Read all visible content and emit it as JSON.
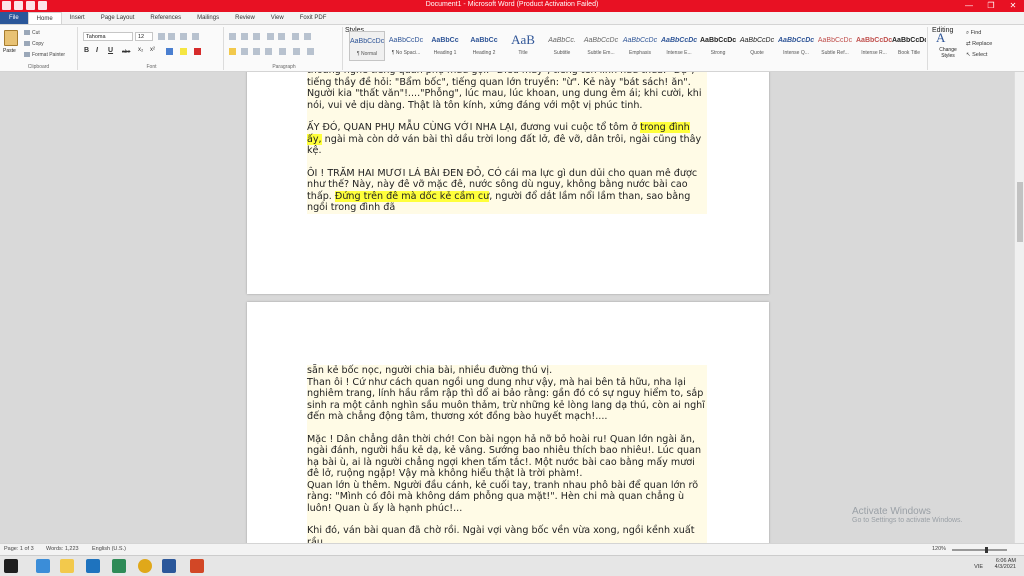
{
  "window": {
    "title": "Document1 - Microsoft Word (Product Activation Failed)",
    "controls": [
      "—",
      "❐",
      "✕"
    ]
  },
  "tabs": [
    "File",
    "Home",
    "Insert",
    "Page Layout",
    "References",
    "Mailings",
    "Review",
    "View",
    "Foxit PDF"
  ],
  "ribbon": {
    "clipboard": {
      "paste": "Paste",
      "cut": "Cut",
      "copy": "Copy",
      "format_painter": "Format Painter",
      "label": "Clipboard"
    },
    "font": {
      "name": "Tahoma",
      "size": "12",
      "label": "Font",
      "bold": "B",
      "italic": "I",
      "underline": "U",
      "strike": "abe",
      "sub": "x₂",
      "sup": "x²"
    },
    "paragraph": {
      "label": "Paragraph"
    },
    "styles": {
      "label": "Styles",
      "items": [
        {
          "sample": "AaBbCcDc",
          "name": "¶ Normal"
        },
        {
          "sample": "AaBbCcDc",
          "name": "¶ No Spaci..."
        },
        {
          "sample": "AaBbCc",
          "name": "Heading 1"
        },
        {
          "sample": "AaBbCc",
          "name": "Heading 2"
        },
        {
          "sample": "AaB",
          "name": "Title"
        },
        {
          "sample": "AaBbCc.",
          "name": "Subtitle"
        },
        {
          "sample": "AaBbCcDc",
          "name": "Subtle Em..."
        },
        {
          "sample": "AaBbCcDc",
          "name": "Emphasis"
        },
        {
          "sample": "AaBbCcDc",
          "name": "Intense E..."
        },
        {
          "sample": "AaBbCcDc",
          "name": "Strong"
        },
        {
          "sample": "AaBbCcDc",
          "name": "Quote"
        },
        {
          "sample": "AaBbCcDc",
          "name": "Intense Q..."
        },
        {
          "sample": "AaBbCcDc",
          "name": "Subtle Ref..."
        },
        {
          "sample": "AaBbCcDc",
          "name": "Intense R..."
        },
        {
          "sample": "AaBbCcDc",
          "name": "Book Title"
        }
      ],
      "change_styles": "Change Styles"
    },
    "editing": {
      "label": "Editing",
      "find": "Find",
      "replace": "Replace",
      "select": "Select"
    }
  },
  "document": {
    "page1_paragraphs": [
      "là nhân nha, dương bệ, ngày ngà. nào quần ngồi trên, nào nha ngồi dưới, người nhà lính lệ khoanh tay sắp hàng, nghi vệ tôn nghiêm, như thần như thánh. Thỉnh thoảng nghe tiếng quan phụ mẫu gọi: \"Điếu mày\", tiếng tên lính hầu thưa: \"Dạ\"; tiếng thầy đề hỏi: \"Bẩm bốc\", tiếng quan lớn truyền: \"ừ\". Kẻ này \"bát sách! ăn\". Người kia \"thất văn\"!....\"Phỗng\", lúc mau, lúc khoan, ung dung êm ái; khi cười, khi nói, vui vẻ dịu dàng. Thật là tôn kính, xứng đáng với một vị phúc tinh.",
      "ẤY ĐÓ, QUAN PHỤ MẪU CÙNG VỚI NHA LẠI, đương vui cuộc tổ tôm ở ",
      "trong đình ấy,",
      " ngài mà còn dở ván bài thì dầu trời long đất lở, đê vỡ, dân trôi, ngài cũng thây kệ.",
      "ÔI ! TRĂM HAI MƯƠI LÁ BÀI ĐEN ĐỎ, CÓ cái ma lực gì dun dủi cho quan mê được như thế? Này, này đê vỡ mặc đê, nước sông dù nguy, không bằng nước bài cao thấp. ",
      "Đứng trên đê mà dốc kẻ cầm cư",
      ", người đổ dắt lầm nổi lầm than, sao bằng ngồi trong đình đã"
    ],
    "page2_paragraphs": [
      "sẵn kẻ bốc nọc, người chia bài, nhiều đường thú vị.\nThan ôi ! Cứ như cách quan ngồi ung dung như vậy, mà hai bên tả hữu, nha lại nghiêm trang, lính hầu rầm rập thì dổ ai bảo rằng: gần đó có sự nguy hiểm to, sắp sinh ra một cảnh nghìn sầu muôn thảm, trừ những kẻ lòng lang dạ thú, còn ai nghĩ đến mà chẳng động tâm, thương xót đồng bào huyết mạch!....",
      "Mặc ! Dân chẳng dân thời chớ! Con bài ngọn hả nỡ bỏ hoài ru! Quan lớn ngài ăn, ngài đánh, người hầu kẻ dạ, kẻ vâng. Sướng bao nhiêu thích bao nhiêu!. Lúc quan hạ bài ù, ai là người chẳng ngợi khen tấm tắc!. Một nước bài cao bằng mấy mươi đê lở, ruộng ngập! Vậy mà không hiểu thật là trời phàm!.\nQuan lớn ù thêm. Người đầu cánh, kẻ cuối tay, tranh nhau phô bài để quan lớn rõ ràng: \"Mình có đôi mà không dám phỗng qua mặt!\". Hèn chi mà quan chẳng ù luôn! Quan ù ấy là hạnh phúc!...",
      "Khi đó, ván bài quan đã chờ rồi. Ngài vợi vàng bốc vền vừa xong, ngồi kềnh xuất rầu"
    ]
  },
  "watermark": {
    "line1": "Activate Windows",
    "line2": "Go to Settings to activate Windows."
  },
  "status": {
    "page": "Page: 1 of 3",
    "words": "Words: 1,223",
    "language": "English (U.S.)",
    "zoom": "120%"
  },
  "tray": {
    "lang": "VIE",
    "time": "6:06 AM",
    "date": "4/3/2021"
  },
  "colors": {
    "titlebar": "#e81123",
    "file_tab": "#2b579a",
    "highlight": "#ffff3b"
  }
}
